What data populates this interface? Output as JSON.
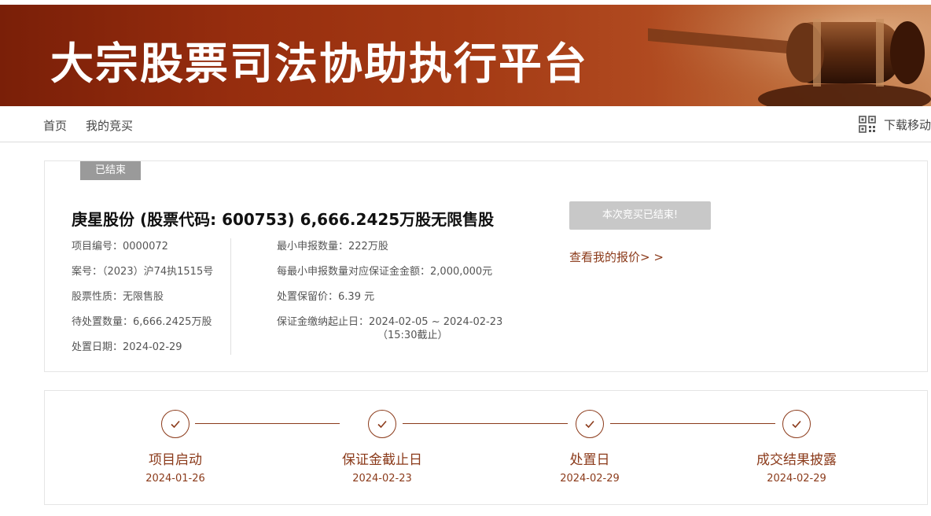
{
  "banner": {
    "title": "大宗股票司法协助执行平台"
  },
  "nav": {
    "home": "首页",
    "my_bids": "我的竞买",
    "download": "下载移动",
    "download_icon": "qrcode-icon"
  },
  "project": {
    "status": "已结束",
    "title": "庚星股份 (股票代码: 600753) 6,666.2425万股无限售股",
    "left": [
      {
        "label": "项目编号：",
        "value": "0000072"
      },
      {
        "label": "案号：",
        "value": "（2023）沪74执1515号"
      },
      {
        "label": "股票性质：",
        "value": "无限售股"
      },
      {
        "label": "待处置数量：",
        "value": "6,666.2425万股"
      },
      {
        "label": "处置日期：",
        "value": "2024-02-29"
      }
    ],
    "right": [
      {
        "label": "最小申报数量：",
        "value": "222万股"
      },
      {
        "label": "每最小申报数量对应保证金金额：",
        "value": "2,000,000元"
      },
      {
        "label": "处置保留价：",
        "value": "6.39 元"
      },
      {
        "label": "保证金缴纳起止日：",
        "value": "2024-02-05 ~ 2024-02-23",
        "sub": "（15:30截止）"
      }
    ],
    "ended_button": "本次竞买已结束!",
    "my_bid_link": "查看我的报价> >"
  },
  "timeline": {
    "colors": {
      "accent": "#8b3a1a"
    },
    "steps": [
      {
        "name": "项目启动",
        "date": "2024-01-26",
        "icon": "check-icon"
      },
      {
        "name": "保证金截止日",
        "date": "2024-02-23",
        "icon": "check-icon"
      },
      {
        "name": "处置日",
        "date": "2024-02-29",
        "icon": "check-icon"
      },
      {
        "name": "成交结果披露",
        "date": "2024-02-29",
        "icon": "check-icon"
      }
    ]
  }
}
